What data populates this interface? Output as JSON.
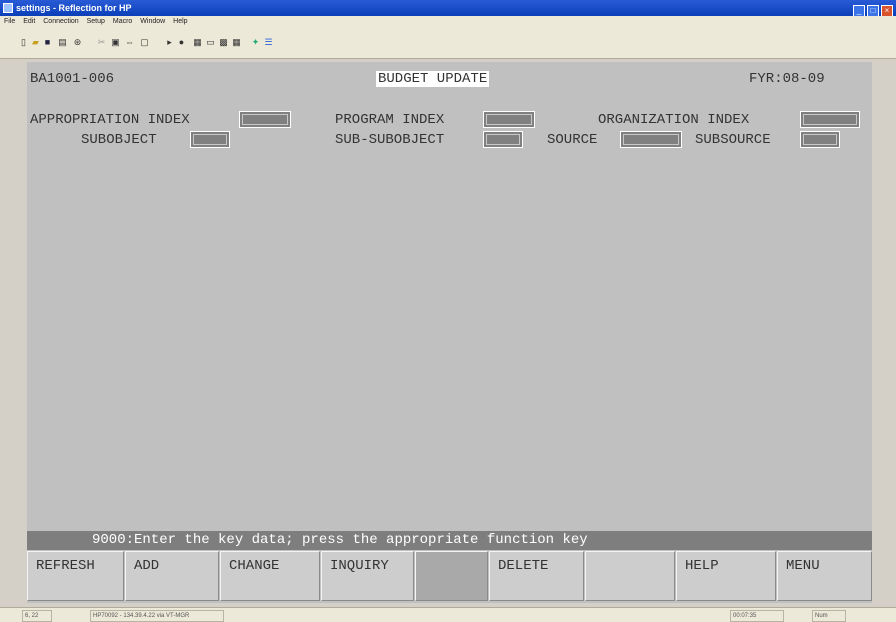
{
  "window": {
    "title": "settings - Reflection for HP"
  },
  "menu": [
    "File",
    "Edit",
    "Connection",
    "Setup",
    "Macro",
    "Window",
    "Help"
  ],
  "toolbar_icons": [
    "new-icon",
    "open-icon",
    "save-icon",
    "print-icon",
    "find-icon",
    "cut-icon",
    "copy-icon",
    "connect-icon",
    "disconnect-icon",
    "play-icon",
    "stop-icon",
    "grid-icon",
    "chat-icon",
    "capture-icon",
    "keyboard-icon",
    "tools-icon",
    "palette-icon"
  ],
  "screen": {
    "screen_id": "BA1001-006",
    "title": "BUDGET UPDATE",
    "fiscal_year": "FYR:08-09",
    "labels": {
      "appropriation_index": "APPROPRIATION INDEX",
      "program_index": "PROGRAM INDEX",
      "organization_index": "ORGANIZATION INDEX",
      "subobject": "SUBOBJECT",
      "sub_subobject": "SUB-SUBOBJECT",
      "source": "SOURCE",
      "subsource": "SUBSOURCE"
    },
    "message": "9000:Enter the key data; press the appropriate function key"
  },
  "function_keys": [
    "REFRESH",
    "ADD",
    "CHANGE",
    "INQUIRY",
    "",
    "DELETE",
    "",
    "HELP",
    "MENU"
  ],
  "statusbar": {
    "pos": "6, 22",
    "connection": "HP70092 - 134.39.4.22 via VT-MGR",
    "time": "00:07:35",
    "mode": "Num"
  }
}
